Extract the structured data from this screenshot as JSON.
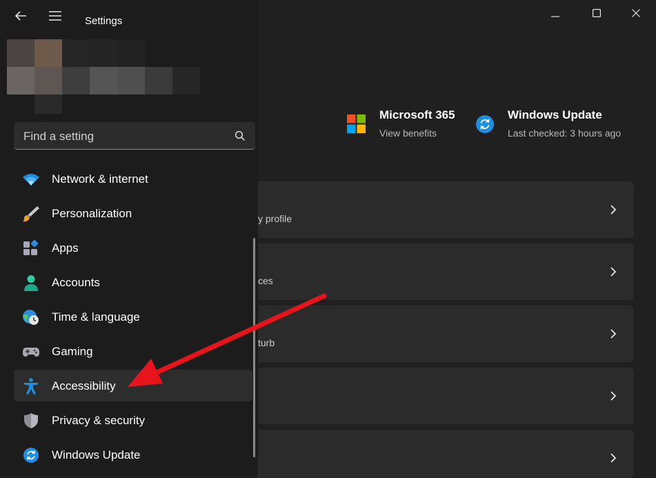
{
  "window": {
    "title": "Settings"
  },
  "search": {
    "placeholder": "Find a setting"
  },
  "nav": {
    "items": [
      {
        "label": "Network & internet",
        "icon": "wifi-icon"
      },
      {
        "label": "Personalization",
        "icon": "brush-icon"
      },
      {
        "label": "Apps",
        "icon": "apps-icon"
      },
      {
        "label": "Accounts",
        "icon": "person-icon"
      },
      {
        "label": "Time & language",
        "icon": "globe-clock-icon"
      },
      {
        "label": "Gaming",
        "icon": "gamepad-icon"
      },
      {
        "label": "Accessibility",
        "icon": "accessibility-icon",
        "active": true
      },
      {
        "label": "Privacy & security",
        "icon": "shield-icon"
      },
      {
        "label": "Windows Update",
        "icon": "update-icon"
      }
    ]
  },
  "promos": {
    "microsoft365": {
      "title": "Microsoft 365",
      "subtitle": "View benefits"
    },
    "windows_update": {
      "title": "Windows Update",
      "subtitle": "Last checked: 3 hours ago"
    }
  },
  "cards": [
    {
      "subtitle_fragment": "y profile"
    },
    {
      "subtitle_fragment": "ces"
    },
    {
      "subtitle_fragment": "turb"
    },
    {
      "subtitle_fragment": ""
    },
    {
      "subtitle_fragment": ""
    }
  ],
  "colors": {
    "background": "#202020",
    "nav_background": "#1c1c1c",
    "card_background": "#2b2b2b",
    "accent_blue": "#1e8fe0",
    "annotation_red": "#e8141b"
  }
}
